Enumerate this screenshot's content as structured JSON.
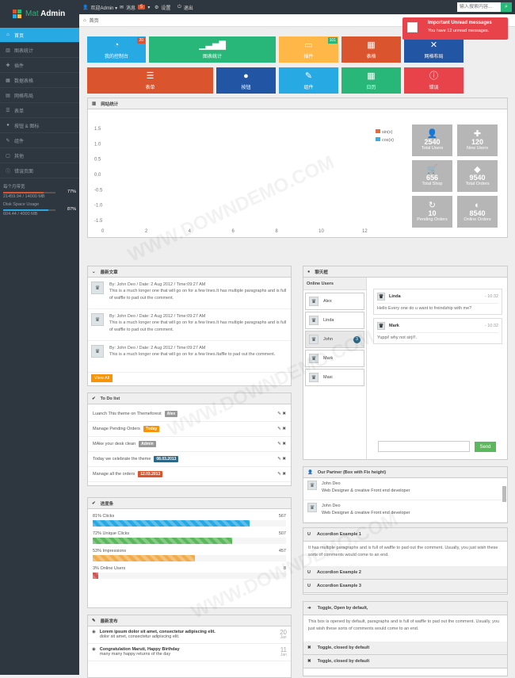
{
  "header": {
    "logo_prefix": "Mat",
    "logo_name": "Admin",
    "welcome": "欢迎Admin ▾",
    "messages_label": "消息",
    "messages_count": "5",
    "settings": "设置",
    "logout": "退出",
    "search_placeholder": "输入搜索内容..."
  },
  "breadcrumb": {
    "home": "首页"
  },
  "notification": {
    "title": "Important Unread messages",
    "text": "You have 12 unread messages."
  },
  "sidebar": {
    "items": [
      {
        "label": "首页",
        "icon": "home-icon"
      },
      {
        "label": "图表统计",
        "icon": "chart-icon"
      },
      {
        "label": "插件",
        "icon": "puzzle-icon"
      },
      {
        "label": "数据表格",
        "icon": "table-icon"
      },
      {
        "label": "网格布局",
        "icon": "grid-icon"
      },
      {
        "label": "表单",
        "icon": "form-icon"
      },
      {
        "label": "按钮 & 图标",
        "icon": "tint-icon"
      },
      {
        "label": "组件",
        "icon": "pencil-icon"
      },
      {
        "label": "其他",
        "icon": "file-icon"
      },
      {
        "label": "错误页面",
        "icon": "info-icon"
      }
    ],
    "progress": [
      {
        "label": "每个月带宽",
        "value": "21459.94 / 14000 MB",
        "pct": "77%",
        "fill": 0.77,
        "color": "#da542e"
      },
      {
        "label": "Disk Space Usage",
        "value": "604.44 / 4000 MB",
        "pct": "87%",
        "fill": 0.87,
        "color": "#27a9e3"
      }
    ]
  },
  "tiles": [
    {
      "label": "我的控制台",
      "badge": "20",
      "badge_color": "#da542e",
      "color": "#27a9e3",
      "icon": "dashboard-icon"
    },
    {
      "label": "图表统计",
      "color": "#28b779",
      "icon": "signal-icon"
    },
    {
      "label": "插件",
      "badge": "101",
      "badge_color": "#28b779",
      "color": "#ffb848",
      "icon": "inbox-icon"
    },
    {
      "label": "表格",
      "color": "#da542e",
      "icon": "table-icon"
    },
    {
      "label": "网格布局",
      "color": "#2255a4",
      "icon": "fullscreen-icon"
    },
    {
      "label": "表单",
      "color": "#da542e",
      "icon": "list-icon"
    },
    {
      "label": "按钮",
      "color": "#2255a4",
      "icon": "tint-icon"
    },
    {
      "label": "组件",
      "color": "#27a9e3",
      "icon": "pencil-icon"
    },
    {
      "label": "日历",
      "color": "#28b779",
      "icon": "calendar-icon"
    },
    {
      "label": "错误",
      "color": "#e8434a",
      "icon": "info-icon"
    }
  ],
  "site_stats": {
    "title": "网站统计",
    "stats": [
      {
        "value": "2540",
        "label": "Total Users",
        "icon": "user-icon"
      },
      {
        "value": "120",
        "label": "New Users",
        "icon": "plus-icon"
      },
      {
        "value": "656",
        "label": "Total Shop",
        "icon": "cart-icon"
      },
      {
        "value": "9540",
        "label": "Total Orders",
        "icon": "tag-icon"
      },
      {
        "value": "10",
        "label": "Pending Orders",
        "icon": "repeat-icon"
      },
      {
        "value": "8540",
        "label": "Online Orders",
        "icon": "globe-icon"
      }
    ]
  },
  "chart_data": {
    "type": "line",
    "x": [
      0,
      2,
      4,
      6,
      8,
      10,
      12
    ],
    "ylim": [
      -1.5,
      1.5
    ],
    "y_ticks": [
      "1.5",
      "1.0",
      "0.5",
      "0.0",
      "-0.5",
      "-1.0",
      "-1.5"
    ],
    "x_ticks": [
      "0",
      "2",
      "4",
      "6",
      "8",
      "10",
      "12"
    ],
    "series": [
      {
        "name": "sin(x)",
        "color": "#e66a3b"
      },
      {
        "name": "cos(x)",
        "color": "#3fa9e0"
      }
    ],
    "legend": "top-right"
  },
  "articles": {
    "title": "最新文章",
    "items": [
      {
        "meta": "By: John Deo / Date: 2 Aug 2012 / Time:09:27 AM",
        "text": "This is a much longer one that will go on for a few lines.It has multiple paragraphs and is full of waffle to pad out the comment."
      },
      {
        "meta": "By: John Deo / Date: 2 Aug 2012 / Time:09:27 AM",
        "text": "This is a much longer one that will go on for a few lines.It has multiple paragraphs and is full of waffle to pad out the comment."
      },
      {
        "meta": "By: John Deo / Date: 2 Aug 2012 / Time:09:27 AM",
        "text": "This is a much longer one that will go on for a few lines.Itaffle to pad out the comment."
      }
    ],
    "view_all": "View All"
  },
  "todo": {
    "title": "To Do list",
    "items": [
      {
        "text": "Luanch This theme on Themeforest",
        "tag": "Alex",
        "tag_color": "#999"
      },
      {
        "text": "Manage Pending Orders",
        "tag": "Today",
        "tag_color": "#f89406"
      },
      {
        "text": "MAke your desk clean",
        "tag": "Admin",
        "tag_color": "#999"
      },
      {
        "text": "Today we celebrate the theme",
        "tag": "08.03.2013",
        "tag_color": "#2d6987"
      },
      {
        "text": "Manage all the orders",
        "tag": "12.03.2013",
        "tag_color": "#da542e"
      }
    ]
  },
  "progress": {
    "title": "进度条",
    "items": [
      {
        "label": "81% Clicks",
        "value": "567",
        "fill": 0.81,
        "color": "#27a9e3"
      },
      {
        "label": "72% Unique Clicks",
        "value": "507",
        "fill": 0.72,
        "color": "#5cb85c"
      },
      {
        "label": "53% Impressions",
        "value": "457",
        "fill": 0.53,
        "color": "#f0ad4e"
      },
      {
        "label": "3% Online Users",
        "value": "8",
        "fill": 0.03,
        "color": "#d9534f"
      }
    ]
  },
  "posts": {
    "title": "最新发布",
    "items": [
      {
        "title": "Lorem ipsum dolor sit amet, consectetur adipiscing elit.",
        "text": "dolor sit amet, consectetur adipiscing elit.",
        "day": "20",
        "month": "Jan"
      },
      {
        "title": "Congratulation Maruti, Happy Birthday",
        "text": "many many happy returns of the day",
        "day": "11",
        "month": "Jan"
      }
    ]
  },
  "chat": {
    "title": "聊天框",
    "online_label": "Online Users",
    "users": [
      {
        "name": "Alex"
      },
      {
        "name": "Linda"
      },
      {
        "name": "John",
        "badge": "3"
      },
      {
        "name": "Mark"
      },
      {
        "name": "Maxi"
      }
    ],
    "messages": [
      {
        "name": "Linda",
        "time": "- 10:32",
        "text": "Hello Every one do u want to freindship with me?"
      },
      {
        "name": "Mark",
        "time": "- 10:32",
        "text": "Yuppi! why not sirji!!."
      }
    ],
    "send": "Send"
  },
  "partner": {
    "title": "Our Partner (Box with Fix height)",
    "items": [
      {
        "name": "John Deo",
        "role": "Web Designer & creative Front end developer"
      },
      {
        "name": "John Deo",
        "role": "Web Designer & creative Front end developer"
      }
    ]
  },
  "accordion": {
    "items": [
      {
        "title": "Accordion Example 1",
        "text": "It has multiple paragraphs and is full of waffle to pad out the comment. Usually, you just wish these sorts of comments would come to an end."
      },
      {
        "title": "Accordion Example 2"
      },
      {
        "title": "Accordion Example 3"
      }
    ]
  },
  "toggles": [
    {
      "title": "Toggle, Open by default,",
      "text": "This box is opened by default, paragraphs and is full of waffle to pad out the comment. Usually, you just wish these sorts of comments would come to an end."
    },
    {
      "title": "Toggle, closed by default"
    },
    {
      "title": "Toggle, closed by default"
    }
  ]
}
